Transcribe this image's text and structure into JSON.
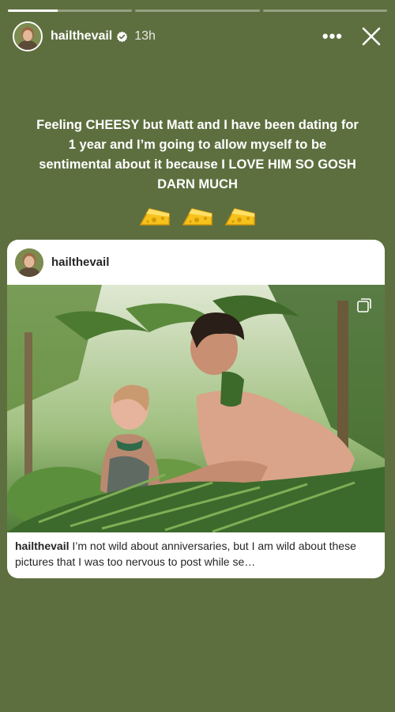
{
  "story": {
    "progress": [
      1,
      0,
      0
    ],
    "user": {
      "username": "hailthevail",
      "verified": true,
      "time": "13h"
    },
    "more_label": "•••",
    "caption": "Feeling CHEESY but Matt and I have been dating for 1 year and I’m going to allow myself to be sentimental about it because I LOVE HIM SO GOSH DARN MUCH",
    "stickers": [
      "cheese-icon",
      "cheese-icon",
      "cheese-icon"
    ]
  },
  "post": {
    "username": "hailthevail",
    "caption_user": "hailthevail",
    "caption_text": " I’m not wild about anniversaries, but I am wild about these pictures that I was too nervous to post while se…"
  },
  "colors": {
    "background": "#5e6f3f",
    "text": "#ffffff",
    "card": "#ffffff"
  }
}
